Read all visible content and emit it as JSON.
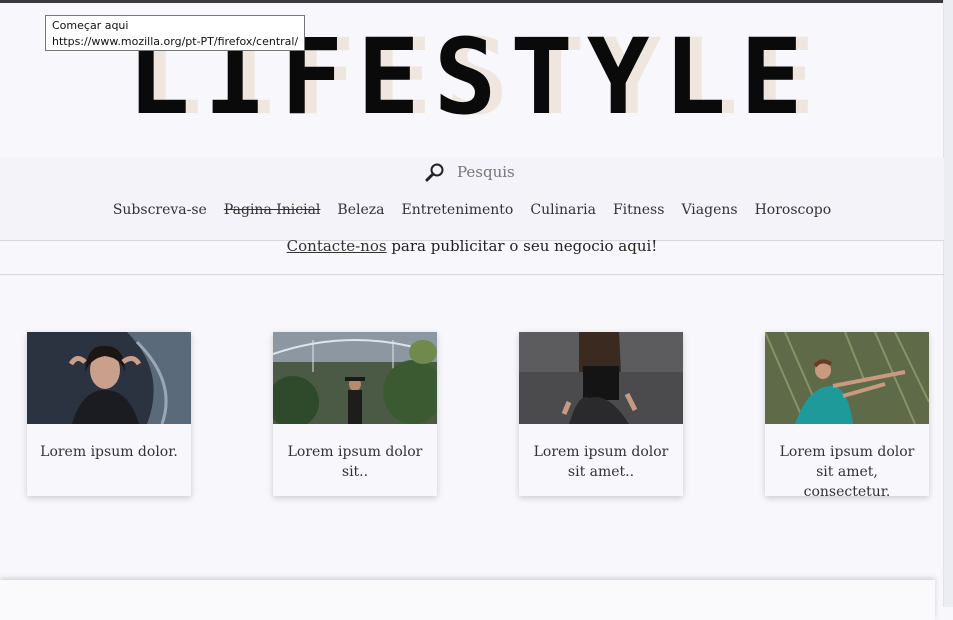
{
  "tooltip": {
    "title": "Começar aqui",
    "url": "https://www.mozilla.org/pt-PT/firefox/central/"
  },
  "logo": {
    "text": "LIFESTYLE",
    "shadow_color": "#efe6df"
  },
  "search": {
    "icon": "search-icon",
    "placeholder": "Pesquis"
  },
  "nav": {
    "items": [
      "Subscreva-se",
      "Pagina Inicial",
      "Beleza",
      "Entretenimento",
      "Culinaria",
      "Fitness",
      "Viagens",
      "Horoscopo"
    ]
  },
  "promo": {
    "link": "Contacte-nos",
    "text": " para publicitar o seu negocio aqui!"
  },
  "cards": [
    {
      "caption": "Lorem ipsum dolor."
    },
    {
      "caption": "Lorem ipsum dolor sit.."
    },
    {
      "caption": "Lorem ipsum dolor sit amet.."
    },
    {
      "caption": "Lorem ipsum dolor sit amet, consectetur."
    }
  ]
}
